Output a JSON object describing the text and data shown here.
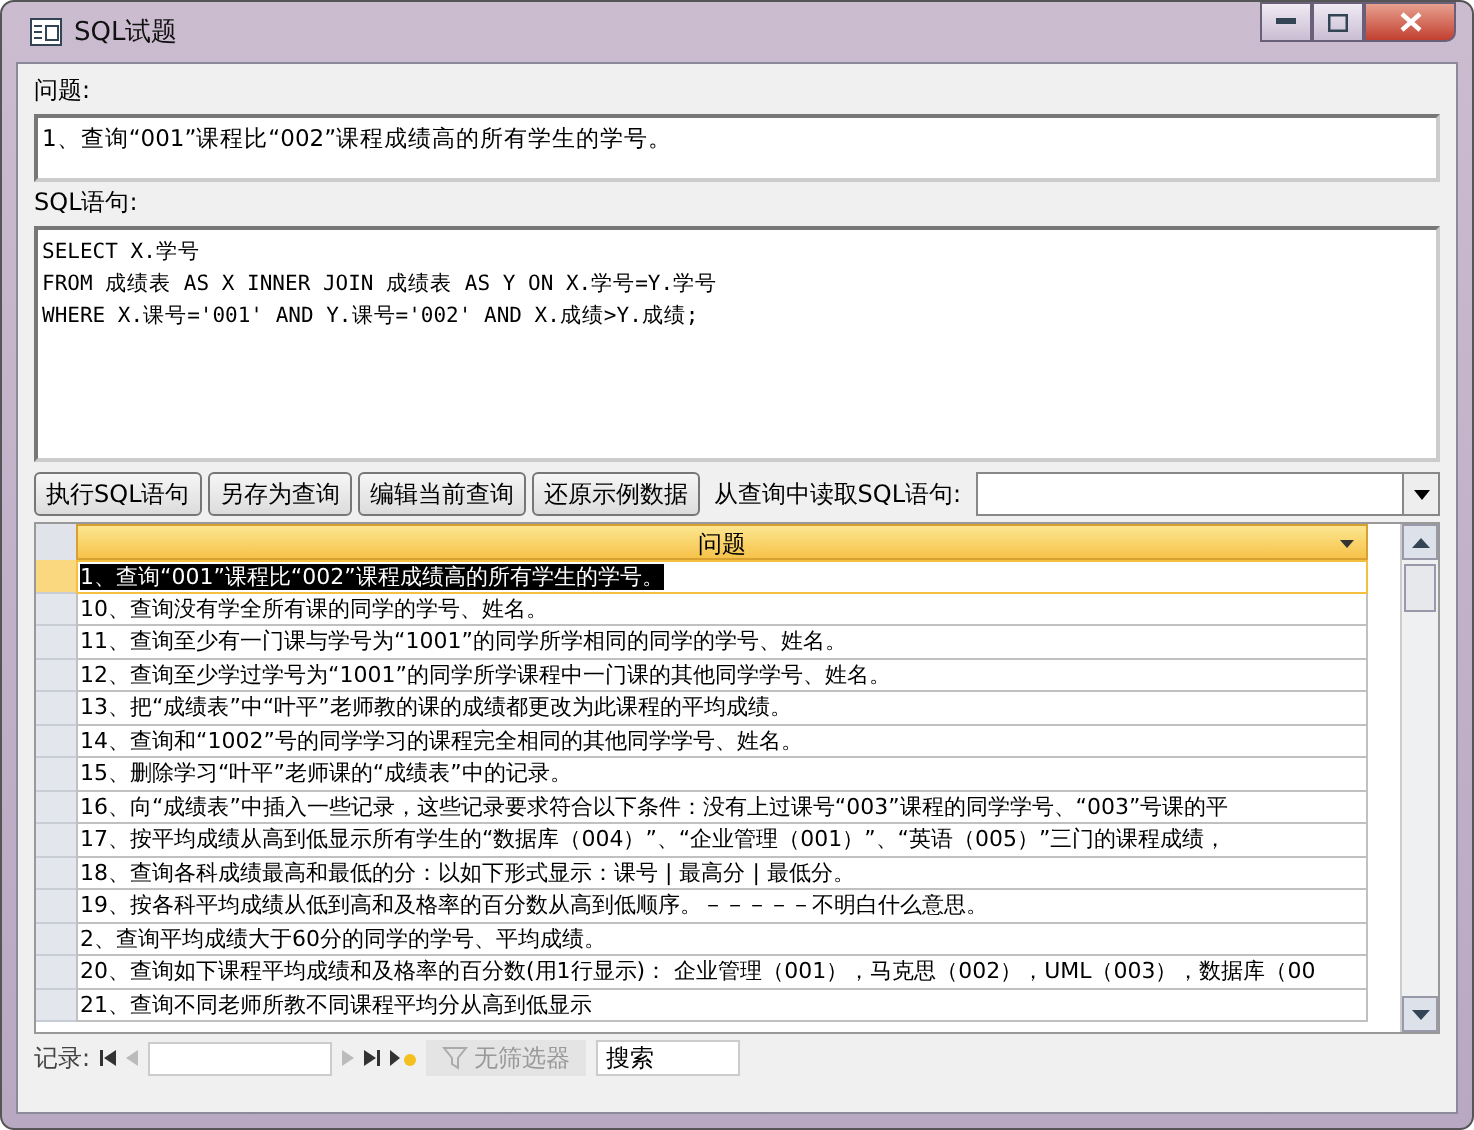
{
  "window": {
    "title": "SQL试题"
  },
  "question": {
    "label": "问题:",
    "value": "1、查询“001”课程比“002”课程成绩高的所有学生的学号。"
  },
  "sql": {
    "label": "SQL语句:",
    "lines": [
      "SELECT X.学号",
      "FROM 成绩表 AS X INNER JOIN 成绩表 AS Y ON X.学号=Y.学号",
      "WHERE X.课号='001' AND Y.课号='002' AND X.成绩>Y.成绩;"
    ]
  },
  "buttons": [
    "执行SQL语句",
    "另存为查询",
    "编辑当前查询",
    "还原示例数据"
  ],
  "query_select": {
    "label": "从查询中读取SQL语句:"
  },
  "table": {
    "column": "问题",
    "rows": [
      {
        "text": "1、查询“001”课程比“002”课程成绩高的所有学生的学号。",
        "selected": true
      },
      {
        "text": "10、查询没有学全所有课的同学的学号、姓名。",
        "selected": false
      },
      {
        "text": "11、查询至少有一门课与学号为“1001”的同学所学相同的同学的学号、姓名。",
        "selected": false
      },
      {
        "text": "12、查询至少学过学号为“1001”的同学所学课程中一门课的其他同学学号、姓名。",
        "selected": false
      },
      {
        "text": "13、把“成绩表”中“叶平”老师教的课的成绩都更改为此课程的平均成绩。",
        "selected": false
      },
      {
        "text": "14、查询和“1002”号的同学学习的课程完全相同的其他同学学号、姓名。",
        "selected": false
      },
      {
        "text": "15、删除学习“叶平”老师课的“成绩表”中的记录。",
        "selected": false
      },
      {
        "text": "16、向“成绩表”中插入一些记录，这些记录要求符合以下条件：没有上过课号“003”课程的同学学号、“003”号课的平",
        "selected": false
      },
      {
        "text": "17、按平均成绩从高到低显示所有学生的“数据库（004）”、“企业管理（001）”、“英语（005）”三门的课程成绩，",
        "selected": false
      },
      {
        "text": "18、查询各科成绩最高和最低的分：以如下形式显示：课号 | 最高分 | 最低分。",
        "selected": false
      },
      {
        "text": "19、按各科平均成绩从低到高和及格率的百分数从高到低顺序。－－－－－不明白什么意思。",
        "selected": false
      },
      {
        "text": "2、查询平均成绩大于60分的同学的学号、平均成绩。",
        "selected": false
      },
      {
        "text": "20、查询如下课程平均成绩和及格率的百分数(用1行显示)： 企业管理（001），马克思（002），UML（003），数据库（00",
        "selected": false
      },
      {
        "text": "21、查询不同老师所教不同课程平均分从高到低显示",
        "selected": false
      }
    ]
  },
  "navigator": {
    "label": "记录:",
    "filter": "无筛选器",
    "search": "搜索"
  }
}
